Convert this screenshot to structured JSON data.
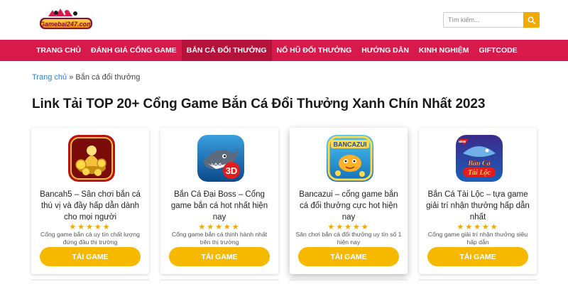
{
  "header": {
    "logo_text": "Gamebai247.com",
    "search_placeholder": "Tìm kiếm...",
    "search_icon": "search-icon"
  },
  "nav": {
    "items": [
      {
        "label": "TRANG CHỦ"
      },
      {
        "label": "ĐÁNH GIÁ CỔNG GAME"
      },
      {
        "label": "BẮN CÁ ĐỔI THƯỞNG"
      },
      {
        "label": "NỔ HŨ ĐỔI THƯỞNG"
      },
      {
        "label": "HƯỚNG DẪN"
      },
      {
        "label": "KINH NGHIỆM"
      },
      {
        "label": "GIFTCODE"
      }
    ],
    "active": "BẮN CÁ ĐỔI THƯỞNG"
  },
  "breadcrumb": {
    "home": "Trang chủ",
    "separator": "»",
    "current": "Bắn cá đổi thưởng"
  },
  "page_title": "Link Tải TOP 20+ Cổng Game Bắn Cá Đổi Thưởng Xanh Chín Nhất 2023",
  "cards": [
    {
      "title": "Bancah5 – Sân chơi bắn cá thú vị và đầy hấp dẫn dành cho mọi người",
      "rating": "★★★★★",
      "description": "Cổng game bắn cá uy tín chất lượng đứng đầu thị trường",
      "button": "TẢI GAME",
      "icon": "gold-coins-icon"
    },
    {
      "title": "Bắn Cá Đại Boss – Cổng game bắn cá hot nhất hiện nay",
      "rating": "★★★★★",
      "description": "Cổng game bắn cá thịnh hành nhất trên thị trường",
      "button": "TẢI GAME",
      "icon": "shark-3d-icon"
    },
    {
      "title": "Bancazui – cổng game bắn cá đổi thưởng cực hot hiện nay",
      "rating": "★★★★★",
      "description": "Sân chơi bắn cá đổi thưởng uy tín số 1 hiện nay",
      "button": "TẢI GAME",
      "icon": "bancazui-icon"
    },
    {
      "title": "Bắn Cá Tài Lộc – tựa game giải trí nhận thưởng hấp dẫn nhất",
      "rating": "★★★★★",
      "description": "Cổng game giải trí nhận thưởng siêu hấp dẫn",
      "button": "TẢI GAME",
      "icon": "ban-ca-tai-loc-icon"
    }
  ],
  "colors": {
    "nav_bg": "#d71a4b",
    "accent": "#f7b900",
    "link": "#2f7ec7"
  }
}
